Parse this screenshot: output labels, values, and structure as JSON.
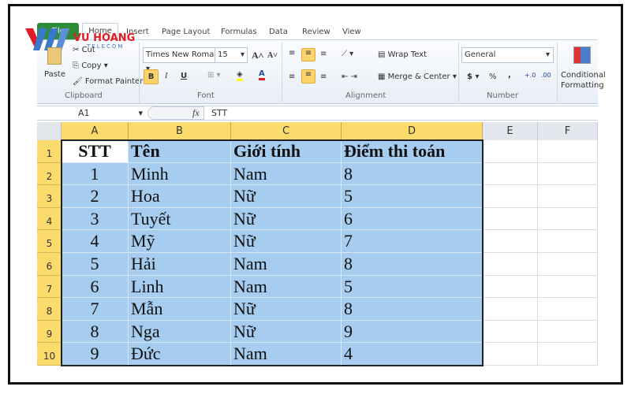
{
  "logo": {
    "brand": "VU HOANG",
    "sub": "TELECOM",
    "colors": {
      "red": "#e21b23",
      "blue": "#3a78c9"
    }
  },
  "tabs": [
    {
      "label": "File"
    },
    {
      "label": "Home"
    },
    {
      "label": "Insert"
    },
    {
      "label": "Page Layout"
    },
    {
      "label": "Formulas"
    },
    {
      "label": "Data"
    },
    {
      "label": "Review"
    },
    {
      "label": "View"
    }
  ],
  "ribbon": {
    "clipboard": {
      "paste": "Paste",
      "cut": "Cut",
      "copy": "Copy",
      "format_painter": "Format Painter",
      "group": "Clipboard"
    },
    "font": {
      "name": "Times New Roma",
      "size": "15",
      "bold": "B",
      "italic": "I",
      "underline": "U",
      "group": "Font"
    },
    "alignment": {
      "wrap": "Wrap Text",
      "merge": "Merge & Center",
      "group": "Alignment"
    },
    "number": {
      "format": "General",
      "currency": "$",
      "percent": "%",
      "comma": ",",
      "group": "Number"
    },
    "styles": {
      "conditional": "Conditional",
      "formatting": "Formatting"
    }
  },
  "formula_bar": {
    "name_box": "A1",
    "fx": "fx",
    "value": "STT"
  },
  "columns": [
    "A",
    "B",
    "C",
    "D",
    "E",
    "F"
  ],
  "rows": [
    "1",
    "2",
    "3",
    "4",
    "5",
    "6",
    "7",
    "8",
    "9",
    "10"
  ],
  "table": {
    "headers": [
      "STT",
      "Tên",
      "Giới tính",
      "Điểm thi toán"
    ],
    "data": [
      [
        "1",
        "Minh",
        "Nam",
        "8"
      ],
      [
        "2",
        "Hoa",
        "Nữ",
        "5"
      ],
      [
        "3",
        "Tuyết",
        "Nữ",
        "6"
      ],
      [
        "4",
        "Mỹ",
        "Nữ",
        "7"
      ],
      [
        "5",
        "Hải",
        "Nam",
        "8"
      ],
      [
        "6",
        "Linh",
        "Nam",
        "5"
      ],
      [
        "7",
        "Mẫn",
        "Nữ",
        "8"
      ],
      [
        "8",
        "Nga",
        "Nữ",
        "9"
      ],
      [
        "9",
        "Đức",
        "Nam",
        "4"
      ]
    ]
  },
  "colors": {
    "selection": "#a6cdf0",
    "header_highlight": "#fbdb6b",
    "file_tab": "#2f8a3a"
  }
}
